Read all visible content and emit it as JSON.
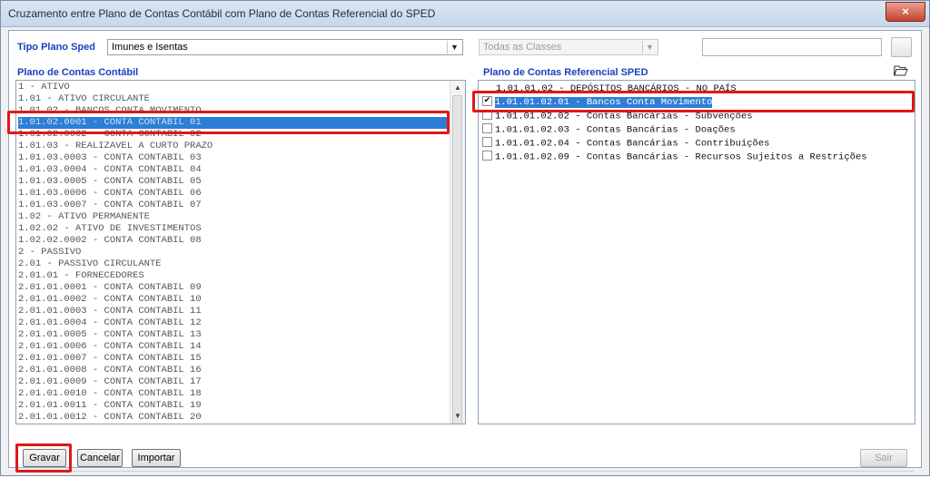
{
  "window": {
    "title": "Cruzamento entre Plano de Contas Contábil com Plano de Contas Referencial do SPED",
    "close_glyph": "×"
  },
  "filters": {
    "tipo_label": "Tipo Plano Sped",
    "tipo_value": "Imunes e Isentas",
    "classes_value": "Todas as Classes",
    "search_value": ""
  },
  "left_panel": {
    "heading": "Plano de Contas Contábil",
    "items": [
      "1 - ATIVO",
      "1.01 - ATIVO CIRCULANTE",
      "1.01.02 - BANCOS CONTA MOVIMENTO",
      "1.01.02.0001 - CONTA CONTABIL 01",
      "1.01.02.0002 - CONTA CONTABIL 02",
      "1.01.03 - REALIZAVEL A CURTO PRAZO",
      "1.01.03.0003 - CONTA CONTABIL 03",
      "1.01.03.0004 - CONTA CONTABIL 04",
      "1.01.03.0005 - CONTA CONTABIL 05",
      "1.01.03.0006 - CONTA CONTABIL 06",
      "1.01.03.0007 - CONTA CONTABIL 07",
      "1.02 - ATIVO PERMANENTE",
      "1.02.02 - ATIVO DE INVESTIMENTOS",
      "1.02.02.0002 - CONTA CONTABIL 08",
      "2 - PASSIVO",
      "2.01 - PASSIVO CIRCULANTE",
      "2.01.01 - FORNECEDORES",
      "2.01.01.0001 - CONTA CONTABIL 09",
      "2.01.01.0002 - CONTA CONTABIL 10",
      "2.01.01.0003 - CONTA CONTABIL 11",
      "2.01.01.0004 - CONTA CONTABIL 12",
      "2.01.01.0005 - CONTA CONTABIL 13",
      "2.01.01.0006 - CONTA CONTABIL 14",
      "2.01.01.0007 - CONTA CONTABIL 15",
      "2.01.01.0008 - CONTA CONTABIL 16",
      "2.01.01.0009 - CONTA CONTABIL 17",
      "2.01.01.0010 - CONTA CONTABIL 18",
      "2.01.01.0011 - CONTA CONTABIL 19",
      "2.01.01.0012 - CONTA CONTABIL 20"
    ],
    "selected_index": 3
  },
  "right_panel": {
    "heading": "Plano de Contas Referencial SPED",
    "items": [
      {
        "label": "1.01.01.02 - DEPÓSITOS BANCÁRIOS - NO PAÍS",
        "checkbox": false,
        "checked": false
      },
      {
        "label": "1.01.01.02.01 - Bancos Conta Movimento",
        "checkbox": true,
        "checked": true
      },
      {
        "label": "1.01.01.02.02 - Contas Bancárias - Subvenções",
        "checkbox": true,
        "checked": false
      },
      {
        "label": "1.01.01.02.03 - Contas Bancárias - Doações",
        "checkbox": true,
        "checked": false
      },
      {
        "label": "1.01.01.02.04 - Contas Bancárias - Contribuições",
        "checkbox": true,
        "checked": false
      },
      {
        "label": "1.01.01.02.09 - Contas Bancárias - Recursos Sujeitos a Restrições",
        "checkbox": true,
        "checked": false
      }
    ],
    "selected_index": 1
  },
  "buttons": {
    "gravar": "Gravar",
    "cancelar": "Cancelar",
    "importar": "Importar",
    "sair": "Sair"
  },
  "colors": {
    "accent_label": "#1a3fbf",
    "selection": "#2d7ed6",
    "highlight_box": "#e01818"
  }
}
